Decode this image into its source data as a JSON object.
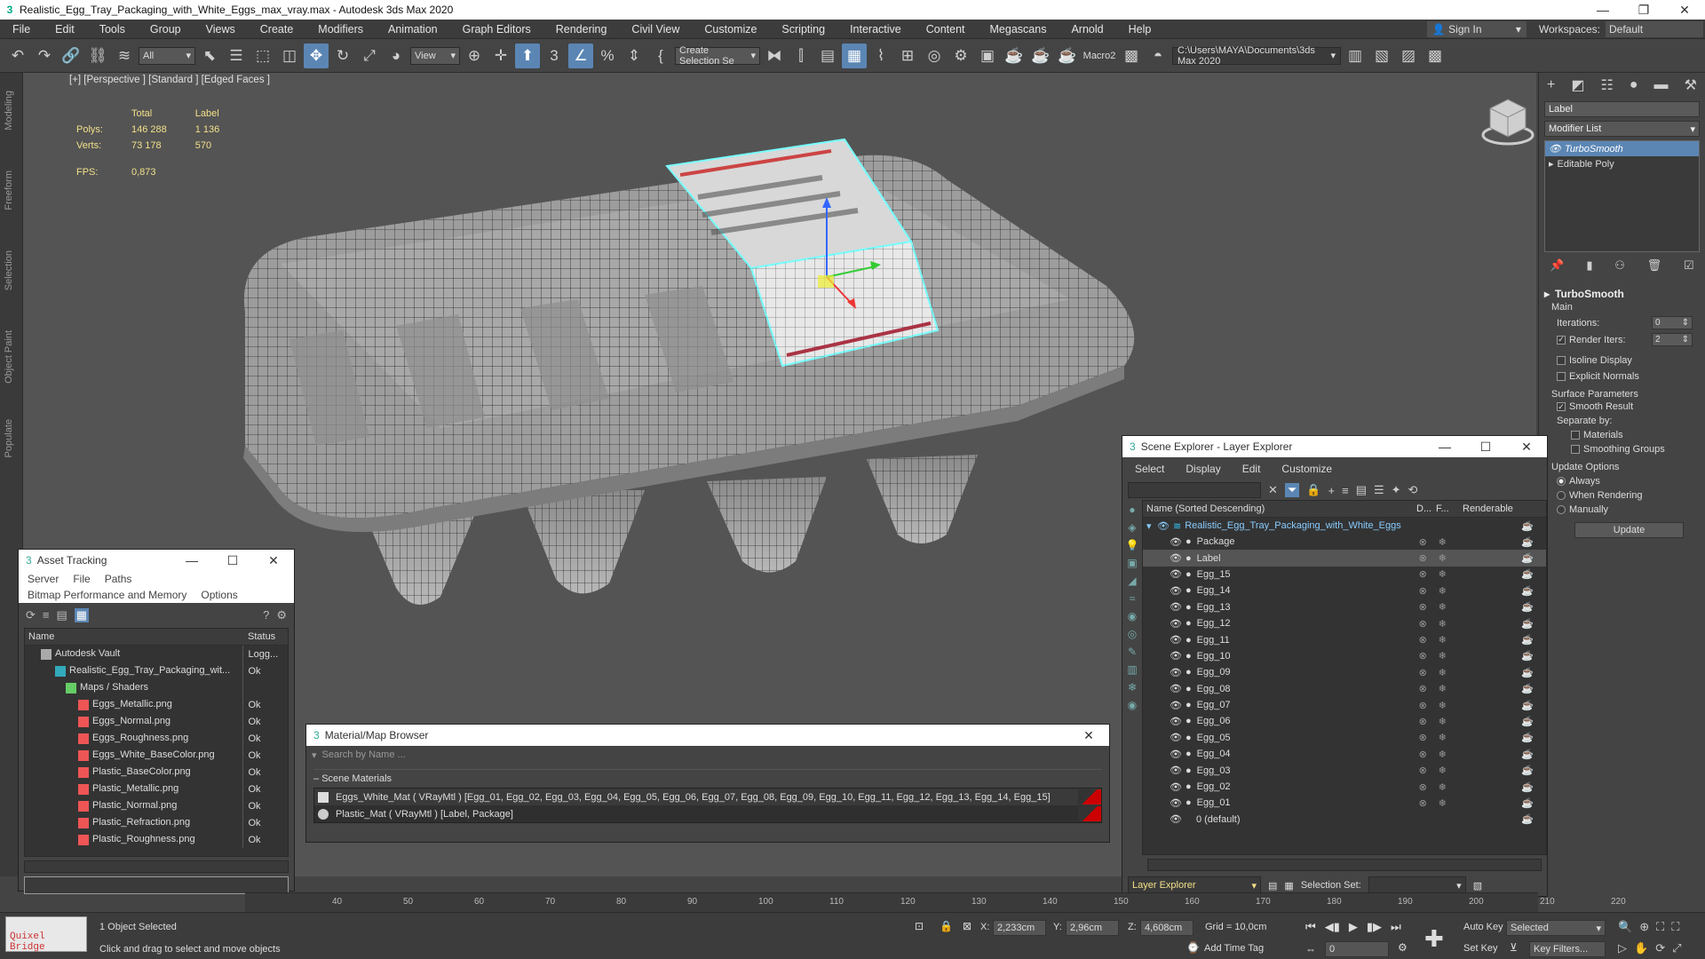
{
  "window": {
    "title": "Realistic_Egg_Tray_Packaging_with_White_Eggs_max_vray.max - Autodesk 3ds Max 2020"
  },
  "menu": [
    "File",
    "Edit",
    "Tools",
    "Group",
    "Views",
    "Create",
    "Modifiers",
    "Animation",
    "Graph Editors",
    "Rendering",
    "Civil View",
    "Customize",
    "Scripting",
    "Interactive",
    "Content",
    "Megascans",
    "Arnold",
    "Help"
  ],
  "signin": {
    "label": "Sign In",
    "workspaces_label": "Workspaces:",
    "workspace": "Default"
  },
  "toolbar": {
    "filter": "All",
    "view": "View",
    "selection_set": "Create Selection Se",
    "macro": "Macro2",
    "path": "C:\\Users\\MAYA\\Documents\\3ds Max 2020"
  },
  "sidebar_tabs": [
    "Modeling",
    "Freeform",
    "Selection",
    "Object Paint",
    "Populate"
  ],
  "viewport": {
    "label": "[+] [Perspective ] [Standard ] [Edged Faces ]",
    "stats": {
      "col_total": "Total",
      "col_label": "Label",
      "polys_label": "Polys:",
      "polys_total": "146 288",
      "polys_label_val": "1 136",
      "verts_label": "Verts:",
      "verts_total": "73 178",
      "verts_label_val": "570",
      "fps_label": "FPS:",
      "fps": "0,873"
    }
  },
  "command_panel": {
    "name": "Label",
    "modifier_list": "Modifier List",
    "stack": [
      "TurboSmooth",
      "Editable Poly"
    ],
    "turbosmooth": {
      "title": "TurboSmooth",
      "main": "Main",
      "iterations_label": "Iterations:",
      "iterations": "0",
      "render_iters_label": "Render Iters:",
      "render_iters": "2",
      "isoline": "Isoline Display",
      "explicit": "Explicit Normals",
      "surface": "Surface Parameters",
      "smooth_result": "Smooth Result",
      "separate": "Separate by:",
      "materials": "Materials",
      "smoothing_groups": "Smoothing Groups",
      "update_options": "Update Options",
      "always": "Always",
      "when_rendering": "When Rendering",
      "manually": "Manually",
      "update_btn": "Update"
    }
  },
  "asset_tracking": {
    "title": "Asset Tracking",
    "menu1": [
      "Server",
      "File",
      "Paths"
    ],
    "menu2": [
      "Bitmap Performance and Memory",
      "Options"
    ],
    "col_name": "Name",
    "col_status": "Status",
    "rows": [
      {
        "name": "Autodesk Vault",
        "status": "Logg..."
      },
      {
        "name": "Realistic_Egg_Tray_Packaging_wit...",
        "status": "Ok"
      },
      {
        "name": "Maps / Shaders",
        "status": ""
      },
      {
        "name": "Eggs_Metallic.png",
        "status": "Ok"
      },
      {
        "name": "Eggs_Normal.png",
        "status": "Ok"
      },
      {
        "name": "Eggs_Roughness.png",
        "status": "Ok"
      },
      {
        "name": "Eggs_White_BaseColor.png",
        "status": "Ok"
      },
      {
        "name": "Plastic_BaseColor.png",
        "status": "Ok"
      },
      {
        "name": "Plastic_Metallic.png",
        "status": "Ok"
      },
      {
        "name": "Plastic_Normal.png",
        "status": "Ok"
      },
      {
        "name": "Plastic_Refraction.png",
        "status": "Ok"
      },
      {
        "name": "Plastic_Roughness.png",
        "status": "Ok"
      }
    ]
  },
  "material_browser": {
    "title": "Material/Map Browser",
    "search": "Search by Name ...",
    "section": "Scene Materials",
    "items": [
      "Eggs_White_Mat  ( VRayMtl ) [Egg_01, Egg_02, Egg_03, Egg_04, Egg_05, Egg_06, Egg_07, Egg_08, Egg_09, Egg_10, Egg_11, Egg_12, Egg_13, Egg_14, Egg_15]",
      "Plastic_Mat  ( VRayMtl ) [Label, Package]"
    ]
  },
  "scene_explorer": {
    "title": "Scene Explorer - Layer Explorer",
    "menu": [
      "Select",
      "Display",
      "Edit",
      "Customize"
    ],
    "col_name": "Name (Sorted Descending)",
    "col_d": "D...",
    "col_f": "F...",
    "col_render": "Renderable",
    "root": "Realistic_Egg_Tray_Packaging_with_White_Eggs",
    "items": [
      "Package",
      "Label",
      "Egg_15",
      "Egg_14",
      "Egg_13",
      "Egg_12",
      "Egg_11",
      "Egg_10",
      "Egg_09",
      "Egg_08",
      "Egg_07",
      "Egg_06",
      "Egg_05",
      "Egg_04",
      "Egg_03",
      "Egg_02",
      "Egg_01"
    ],
    "default_layer": "0 (default)",
    "footer_dropdown": "Layer Explorer",
    "selection_set_label": "Selection Set:"
  },
  "timeline": {
    "ticks": [
      "40",
      "50",
      "60",
      "70",
      "80",
      "90",
      "100",
      "110",
      "120",
      "130",
      "140",
      "150",
      "160",
      "170",
      "180",
      "190",
      "200",
      "210",
      "220"
    ]
  },
  "status": {
    "quixel": "Quixel Bridge",
    "selected": "1 Object Selected",
    "hint": "Click and drag to select and move objects",
    "x_label": "X:",
    "x": "2,233cm",
    "y_label": "Y:",
    "y": "2,96cm",
    "z_label": "Z:",
    "z": "4,608cm",
    "grid": "Grid = 10,0cm",
    "add_time_tag": "Add Time Tag",
    "auto_key": "Auto Key",
    "set_key": "Set Key",
    "key_mode": "Selected",
    "key_filters": "Key Filters...",
    "frame": "0"
  }
}
